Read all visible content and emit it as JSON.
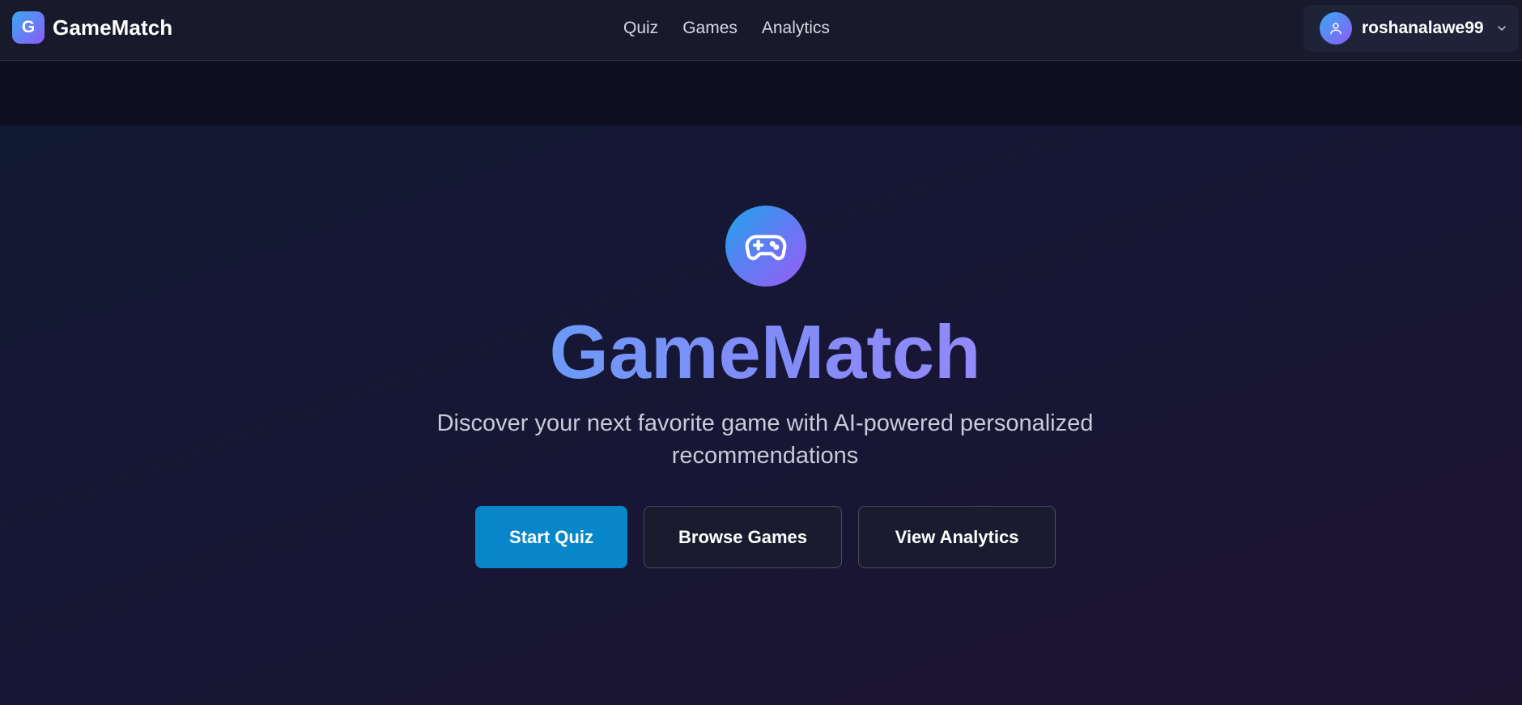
{
  "header": {
    "brand": {
      "logo_letter": "G",
      "name": "GameMatch"
    },
    "nav": [
      {
        "label": "Quiz"
      },
      {
        "label": "Games"
      },
      {
        "label": "Analytics"
      }
    ],
    "user": {
      "username": "roshanalawe99",
      "avatar_icon": "user-icon",
      "menu_icon": "chevron-down-icon"
    }
  },
  "hero": {
    "icon": "gamepad-icon",
    "title": "GameMatch",
    "subtitle_line1": "Discover your next favorite game with AI-powered personalized",
    "subtitle_line2": "recommendations",
    "buttons": {
      "start_quiz": "Start Quiz",
      "browse_games": "Browse Games",
      "view_analytics": "View Analytics"
    }
  },
  "colors": {
    "accent_gradient_start": "#38bdf8",
    "accent_gradient_end": "#c084fc",
    "primary_button": "#0786c9",
    "header_bg": "#181a2b"
  }
}
